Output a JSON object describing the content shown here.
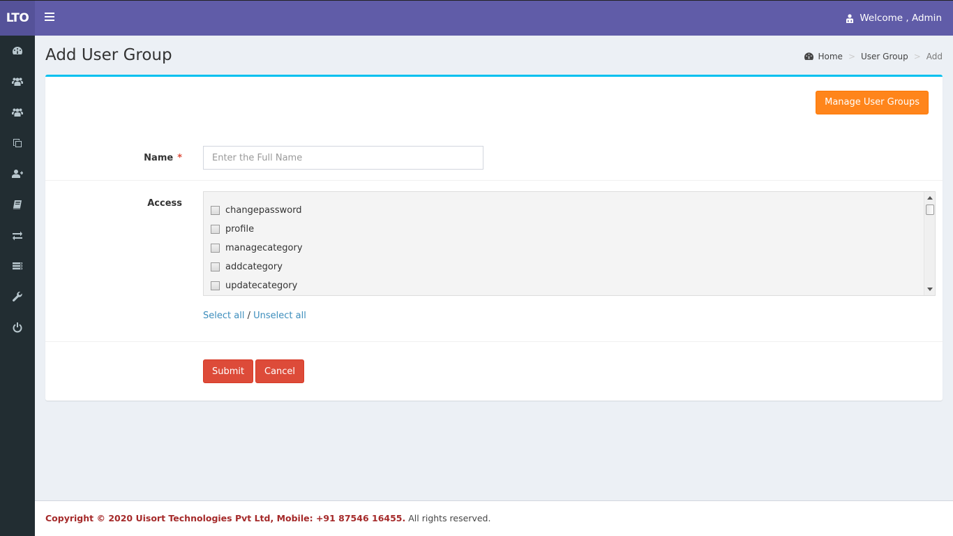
{
  "header": {
    "logo": "LTO",
    "menu_icon": "hamburger-icon",
    "welcome_text": "Welcome , Admin",
    "user_icon": "user-icon",
    "brand_color": "#605ca8"
  },
  "sidebar": {
    "items": [
      {
        "icon": "dashboard-icon"
      },
      {
        "icon": "users-icon"
      },
      {
        "icon": "user-group-icon"
      },
      {
        "icon": "copy-icon"
      },
      {
        "icon": "user-plus-icon"
      },
      {
        "icon": "book-icon"
      },
      {
        "icon": "exchange-icon"
      },
      {
        "icon": "list-icon"
      },
      {
        "icon": "wrench-icon"
      },
      {
        "icon": "power-icon"
      }
    ]
  },
  "page": {
    "title": "Add User Group",
    "breadcrumb": {
      "home": "Home",
      "section": "User Group",
      "current": "Add",
      "separator": ">"
    }
  },
  "form": {
    "manage_button": "Manage User Groups",
    "name_label": "Name",
    "required_mark": "*",
    "name_placeholder": "Enter the Full Name",
    "name_value": "",
    "access_label": "Access",
    "access_items": [
      {
        "label": "changepassword",
        "checked": false
      },
      {
        "label": "profile",
        "checked": false
      },
      {
        "label": "managecategory",
        "checked": false
      },
      {
        "label": "addcategory",
        "checked": false
      },
      {
        "label": "updatecategory",
        "checked": false
      }
    ],
    "select_all": "Select all",
    "slash": "/",
    "unselect_all": "Unselect all",
    "submit": "Submit",
    "cancel": "Cancel"
  },
  "footer": {
    "copyright": "Copyright © 2020 Uisort Technologies Pvt Ltd, Mobile: +91 87546 16455.",
    "rights": "All rights reserved."
  }
}
